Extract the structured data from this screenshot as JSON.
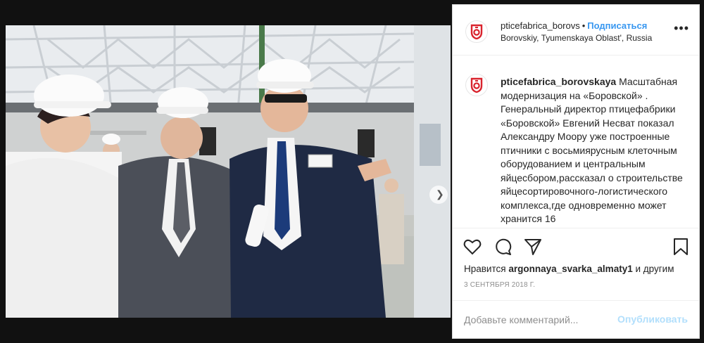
{
  "post": {
    "username": "pticefabrica_borovskaya",
    "header_username": "pticefabrica_borovs",
    "follow_label": "Подписаться",
    "location": "Borovskiy, Tyumenskaya Oblast', Russia",
    "caption": "Масштабная модернизация на «Боровской» . Генеральный директор птицефабрики «Боровской» Евгений Несват показал Александру Моору уже построенные птичники с восьмиярусным клеточным оборудованием и центральным яйцесбором,рассказал о строительстве яйцесортировочного-логистического комплекса,где одновременно может хранится 16",
    "likes_prefix": "Нравится",
    "liker": "argonnaya_svarka_almaty1",
    "likes_suffix": "и другим",
    "date": "3 СЕНТЯБРЯ 2018 Г.",
    "comment_placeholder": "Добавьте комментарий...",
    "publish_label": "Опубликовать"
  },
  "icons": {
    "more": "more-options-icon",
    "like": "heart-icon",
    "comment": "comment-icon",
    "share": "share-icon",
    "save": "bookmark-icon",
    "next": "chevron-right-icon"
  },
  "colors": {
    "accent": "#3897f0",
    "publish_disabled": "#b2dffc",
    "brand_red": "#d9232d"
  }
}
